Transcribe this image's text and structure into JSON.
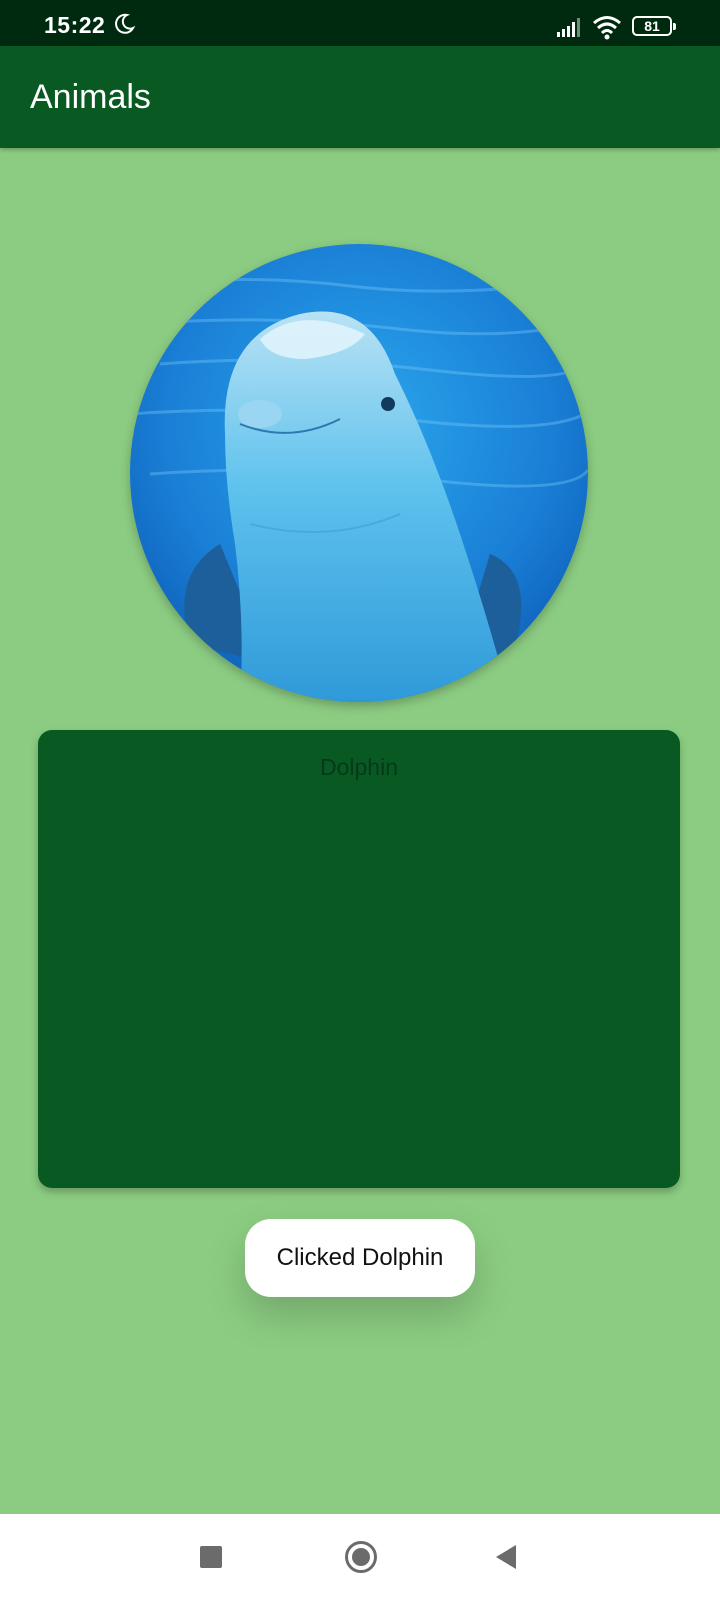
{
  "status_bar": {
    "time": "15:22",
    "battery": "81",
    "icons": [
      "moon-icon",
      "signal-icon",
      "wifi-icon",
      "battery-icon"
    ]
  },
  "app_bar": {
    "title": "Animals"
  },
  "content": {
    "image_subject": "dolphin",
    "animal_name": "Dolphin"
  },
  "toast": {
    "message": "Clicked Dolphin"
  },
  "nav_bar": {
    "icons": [
      "recents-icon",
      "home-icon",
      "back-icon"
    ]
  },
  "colors": {
    "background": "#8ccc82",
    "primary": "#095a22",
    "status_bar": "#002a10",
    "toast_bg": "#ffffff"
  }
}
